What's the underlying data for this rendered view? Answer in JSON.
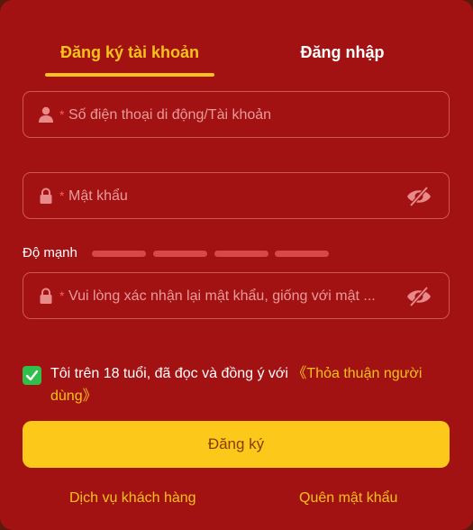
{
  "tabs": {
    "register": "Đăng ký tài khoản",
    "login": "Đăng nhập"
  },
  "form": {
    "phone": {
      "required_mark": "*",
      "placeholder": "Số điện thoại di động/Tài khoản",
      "value": ""
    },
    "password": {
      "required_mark": "*",
      "placeholder": "Mật khẩu",
      "value": ""
    },
    "strength_label": "Độ mạnh",
    "confirm": {
      "required_mark": "*",
      "placeholder": "Vui lòng xác nhận lại mật khẩu, giống với mật ...",
      "value": ""
    }
  },
  "agreement": {
    "checked": true,
    "text": "Tôi trên 18 tuổi, đã đọc và đồng ý với ",
    "link": "《Thỏa thuận người dùng》"
  },
  "submit_label": "Đăng ký",
  "footer": {
    "support": "Dịch vụ khách hàng",
    "forgot": "Quên mật khẩu"
  },
  "colors": {
    "panel_bg": "#a31212",
    "accent": "#f7c21b",
    "button_bg": "#fcc81a",
    "checkbox": "#2fbf4a"
  },
  "icons": {
    "phone_field": "user-icon",
    "password_field": "lock-icon",
    "confirm_field": "lock-icon",
    "visibility_toggle": "eye-slash-icon",
    "checkbox": "check-icon"
  }
}
